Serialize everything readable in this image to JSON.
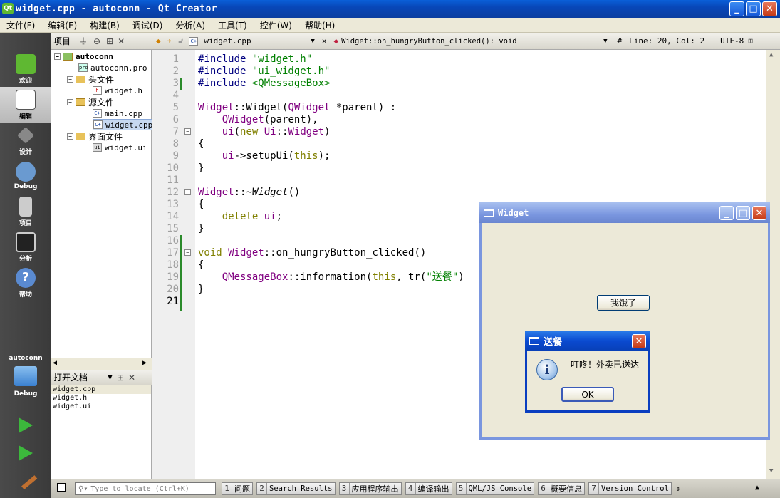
{
  "window": {
    "title": "widget.cpp - autoconn - Qt Creator",
    "logo": "Qt"
  },
  "menu": [
    "文件(F)",
    "编辑(E)",
    "构建(B)",
    "调试(D)",
    "分析(A)",
    "工具(T)",
    "控件(W)",
    "帮助(H)"
  ],
  "modes": [
    {
      "label": "欢迎",
      "icon": "qt-logo-icon"
    },
    {
      "label": "编辑",
      "icon": "edit-icon"
    },
    {
      "label": "设计",
      "icon": "design-icon"
    },
    {
      "label": "Debug",
      "icon": "debug-icon"
    },
    {
      "label": "项目",
      "icon": "project-icon"
    },
    {
      "label": "分析",
      "icon": "analyze-icon"
    },
    {
      "label": "帮助",
      "icon": "help-icon"
    }
  ],
  "target": {
    "project": "autoconn",
    "config": "Debug"
  },
  "navigator": {
    "title": "项目",
    "tree": [
      {
        "label": "autoconn",
        "level": 0,
        "type": "project"
      },
      {
        "label": "autoconn.pro",
        "level": 1,
        "type": "pro"
      },
      {
        "label": "头文件",
        "level": 1,
        "type": "folder"
      },
      {
        "label": "widget.h",
        "level": 2,
        "type": "h"
      },
      {
        "label": "源文件",
        "level": 1,
        "type": "folder"
      },
      {
        "label": "main.cpp",
        "level": 2,
        "type": "cpp"
      },
      {
        "label": "widget.cpp",
        "level": 2,
        "type": "cpp"
      },
      {
        "label": "界面文件",
        "level": 1,
        "type": "folder"
      },
      {
        "label": "widget.ui",
        "level": 2,
        "type": "ui"
      }
    ]
  },
  "open_docs": {
    "title": "打开文档",
    "items": [
      "widget.cpp",
      "widget.h",
      "widget.ui"
    ]
  },
  "editor": {
    "file": "widget.cpp",
    "symbol": "Widget::on_hungryButton_clicked(): void",
    "hash": "#",
    "position": "Line: 20, Col: 2",
    "encoding": "UTF-8",
    "line_numbers": [
      "1",
      "2",
      "3",
      "4",
      "5",
      "6",
      "7",
      "8",
      "9",
      "10",
      "11",
      "12",
      "13",
      "14",
      "15",
      "16",
      "17",
      "18",
      "19",
      "20",
      "21"
    ]
  },
  "locator": {
    "placeholder": "Type to locate (Ctrl+K)"
  },
  "output_panes": [
    {
      "num": "1",
      "label": "问题"
    },
    {
      "num": "2",
      "label": "Search Results"
    },
    {
      "num": "3",
      "label": "应用程序输出"
    },
    {
      "num": "4",
      "label": "编译输出"
    },
    {
      "num": "5",
      "label": "QML/JS Console"
    },
    {
      "num": "6",
      "label": "概要信息"
    },
    {
      "num": "7",
      "label": "Version Control"
    }
  ],
  "widget_window": {
    "title": "Widget",
    "button": "我饿了"
  },
  "message_box": {
    "title": "送餐",
    "text": "叮咚！外卖已送达",
    "ok": "OK"
  }
}
